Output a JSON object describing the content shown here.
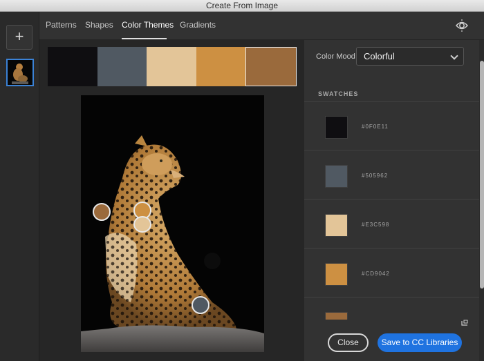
{
  "window": {
    "title": "Create From Image"
  },
  "sidebar": {
    "add_label": "+"
  },
  "tabs": [
    {
      "label": "Patterns",
      "active": false
    },
    {
      "label": "Shapes",
      "active": false
    },
    {
      "label": "Color Themes",
      "active": true
    },
    {
      "label": "Gradients",
      "active": false
    }
  ],
  "theme_strip": [
    {
      "color": "#0F0E11"
    },
    {
      "color": "#505962"
    },
    {
      "color": "#E3C598"
    },
    {
      "color": "#CD9042"
    },
    {
      "color": "#9A6A3C",
      "selected": true
    }
  ],
  "color_mood": {
    "label": "Color Mood",
    "value": "Colorful"
  },
  "swatches": {
    "header": "SWATCHES",
    "items": [
      {
        "hex": "#0F0E11",
        "color": "#0F0E11"
      },
      {
        "hex": "#505962",
        "color": "#505962"
      },
      {
        "hex": "#E3C598",
        "color": "#E3C598"
      },
      {
        "hex": "#CD9042",
        "color": "#CD9042"
      },
      {
        "hex": "#9A6A3C",
        "color": "#9A6A3C"
      }
    ]
  },
  "actions": {
    "close_label": "Close",
    "save_label": "Save to CC Libraries"
  },
  "colors": {
    "accent": "#1F73E0",
    "selection": "#3B82D6"
  }
}
